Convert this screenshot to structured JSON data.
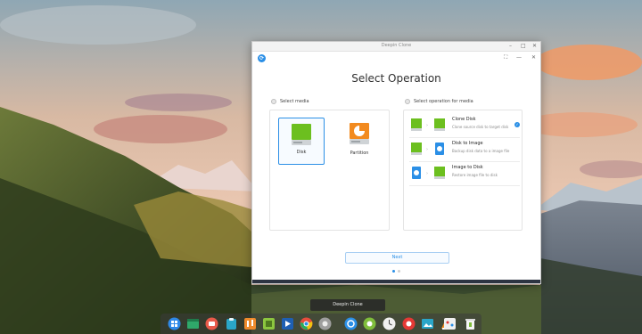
{
  "window": {
    "title": "Deepin Clone",
    "min_glyph": "–",
    "max_glyph": "□",
    "close_glyph": "✕"
  },
  "header": {
    "logo_glyph": "⟳",
    "fullscreen_glyph": "⛶",
    "menu_glyph": "—",
    "close_glyph": "✕"
  },
  "page": {
    "title": "Select Operation"
  },
  "media": {
    "label": "Select media",
    "items": [
      {
        "label": "Disk",
        "selected": true
      },
      {
        "label": "Partition",
        "selected": false
      }
    ]
  },
  "operations": {
    "label": "Select operation for media",
    "items": [
      {
        "title": "Clone Disk",
        "description": "Clone source disk to target disk",
        "selected": true
      },
      {
        "title": "Disk to Image",
        "description": "Backup disk data to a image file",
        "selected": false
      },
      {
        "title": "Image to Disk",
        "description": "Restore image file to disk",
        "selected": false
      }
    ]
  },
  "next_label": "Next",
  "pager": {
    "total": 2,
    "active": 1
  },
  "tooltip": "Deepin Clone",
  "colors": {
    "accent": "#2b8fe6",
    "disk_green": "#6cbf1f",
    "partition_orange": "#f28a1e"
  },
  "dock": {
    "items": [
      {
        "name": "launcher-icon",
        "color": "#2f89e8"
      },
      {
        "name": "terminal-icon",
        "color": "#2fa86a"
      },
      {
        "name": "screenshot-icon",
        "color": "#e85a4a"
      },
      {
        "name": "store-icon",
        "color": "#2aa6c9"
      },
      {
        "name": "music-icon",
        "color": "#ef8b2c"
      },
      {
        "name": "file-manager-icon",
        "color": "#8cc63f"
      },
      {
        "name": "video-icon",
        "color": "#2b8fe6"
      },
      {
        "name": "chrome-icon",
        "color": "#e74c3c"
      },
      {
        "name": "settings-icon",
        "color": "#9e9e9e"
      },
      {
        "name": "deepin-clone-icon",
        "color": "#2b8fe6"
      },
      {
        "name": "green-circle-icon",
        "color": "#7fbd3b"
      },
      {
        "name": "clock-icon",
        "color": "#f0f0f0"
      },
      {
        "name": "red-app-icon",
        "color": "#e53935"
      },
      {
        "name": "image-viewer-icon",
        "color": "#2aa6c9"
      },
      {
        "name": "vlc-icon",
        "color": "#f28a1e"
      },
      {
        "name": "game-icon",
        "color": "#f0f0f0"
      },
      {
        "name": "trash-icon",
        "color": "#f5f5f5"
      }
    ]
  }
}
